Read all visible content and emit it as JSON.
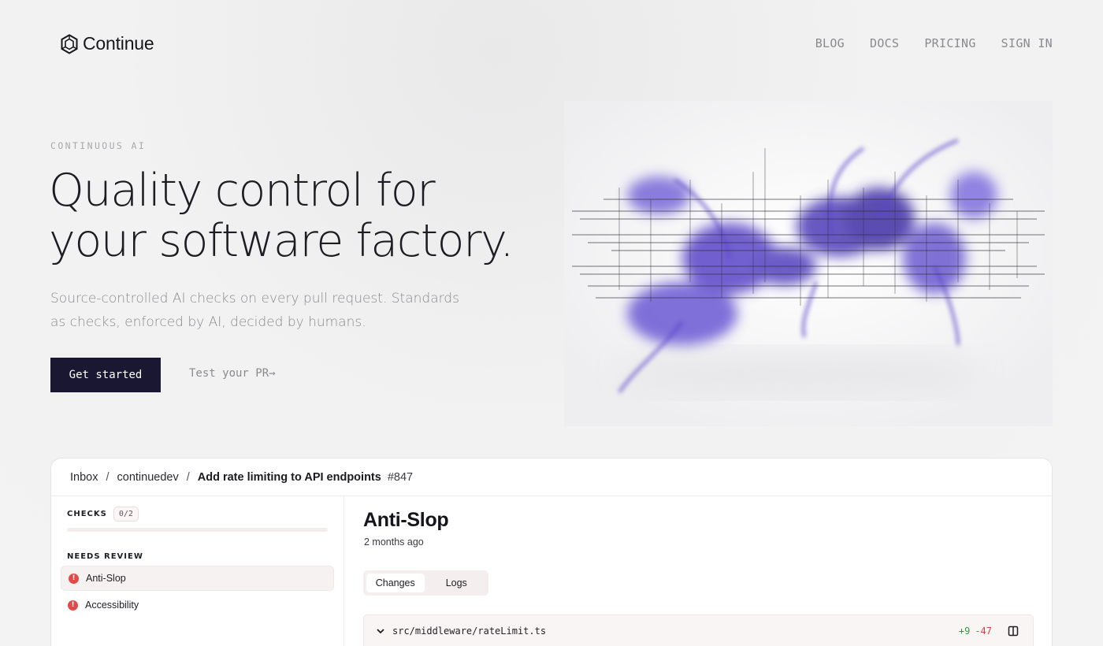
{
  "brand": {
    "name": "Continue",
    "logo_icon": "continue-logo-icon"
  },
  "nav": {
    "items": [
      "BLOG",
      "DOCS",
      "PRICING",
      "SIGN IN"
    ]
  },
  "hero": {
    "eyebrow": "CONTINUOUS AI",
    "headline_line1": "Quality control for",
    "headline_line2": "your software factory.",
    "subtitle": "Source-controlled AI checks on every pull request. Standards as checks, enforced by AI, decided by humans.",
    "cta_primary": "Get started",
    "cta_secondary": "Test your PR→"
  },
  "demo": {
    "breadcrumb": {
      "inbox": "Inbox",
      "separator": "/",
      "org": "continuedev",
      "pr_title": "Add rate limiting to API endpoints",
      "pr_number": "#847"
    },
    "sidebar": {
      "checks_label": "CHECKS",
      "checks_count": "0/2",
      "progress": 0,
      "section_label": "NEEDS REVIEW",
      "items": [
        {
          "label": "Anti-Slop",
          "status": "warning",
          "active": true
        },
        {
          "label": "Accessibility",
          "status": "warning",
          "active": false
        }
      ]
    },
    "main": {
      "title": "Anti-Slop",
      "time": "2 months ago",
      "tabs": [
        {
          "label": "Changes",
          "active": true
        },
        {
          "label": "Logs",
          "active": false
        }
      ],
      "file": {
        "path": "src/middleware/rateLimit.ts",
        "additions": "+9",
        "deletions": "-47"
      }
    }
  },
  "colors": {
    "cta_bg": "#1a1733",
    "accent_purple": "#5b47c9",
    "warning": "#e24a4a",
    "additions": "#2f9d44",
    "deletions": "#d64545"
  }
}
